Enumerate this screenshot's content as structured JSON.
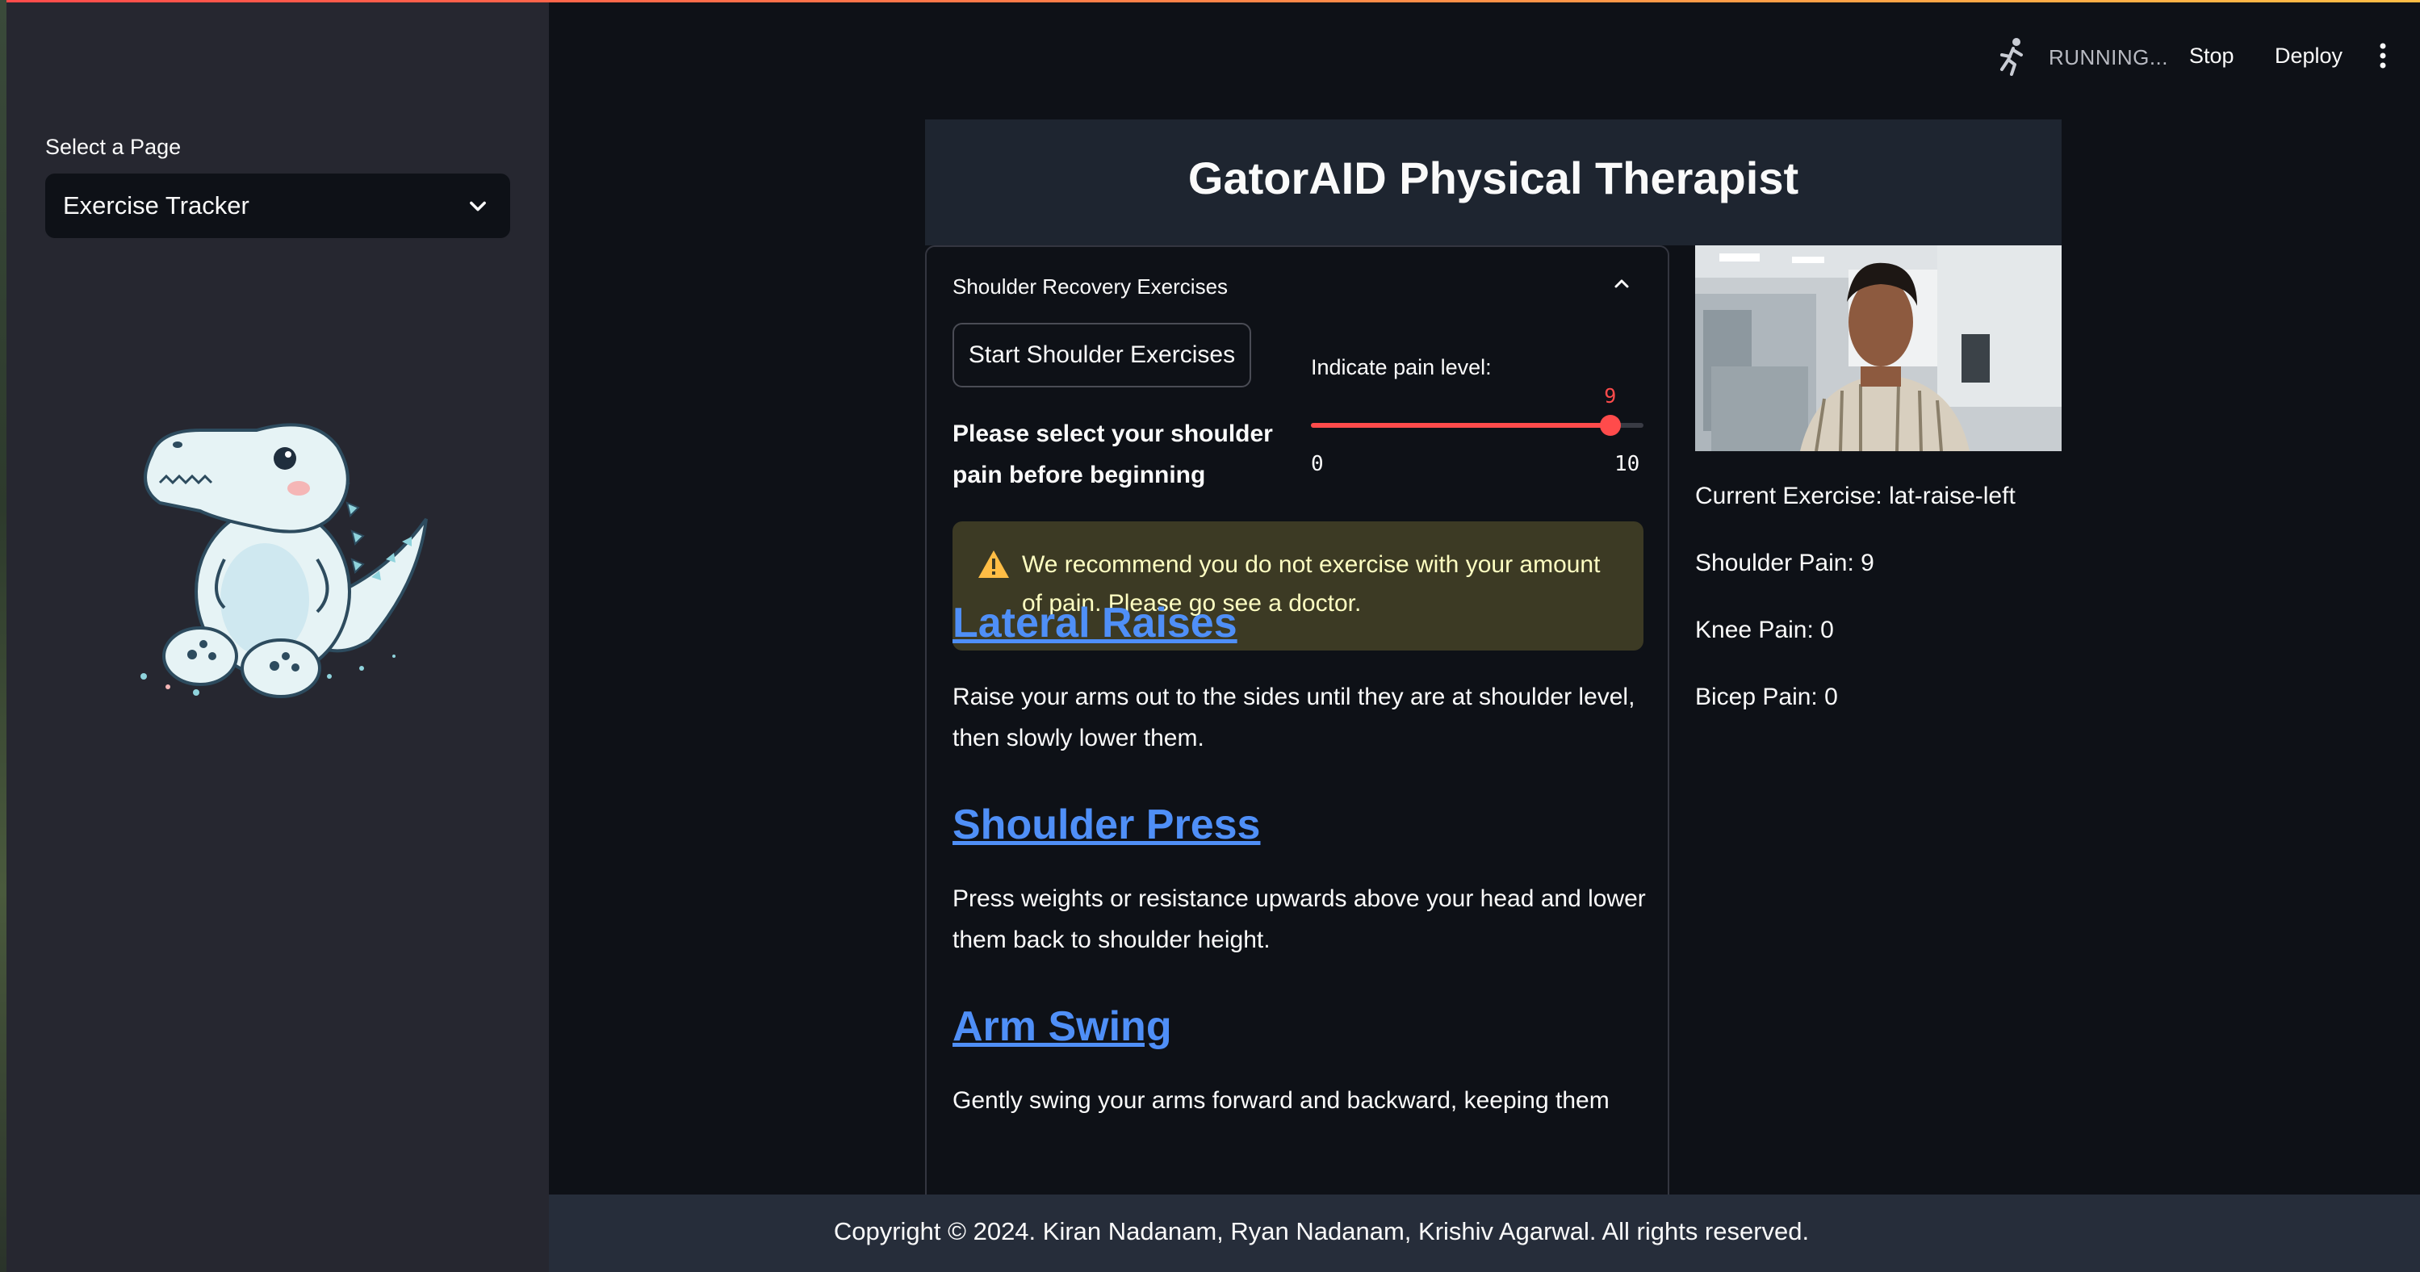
{
  "sidebar": {
    "select_label": "Select a Page",
    "selected_page": "Exercise Tracker",
    "mascot_icon": "alligator-mascot-icon"
  },
  "header": {
    "status": "RUNNING...",
    "stop_label": "Stop",
    "deploy_label": "Deploy",
    "status_icon": "running-person-icon",
    "menu_icon": "kebab-menu-icon"
  },
  "main": {
    "title": "GatorAID Physical Therapist",
    "expander_title": "Shoulder Recovery Exercises",
    "start_button": "Start Shoulder Exercises",
    "prompt": "Please select your shoulder pain before beginning",
    "pain_label": "Indicate pain level:",
    "pain_slider": {
      "value": "9",
      "min": "0",
      "max": "10",
      "value_fraction": 0.9
    },
    "warning": "We recommend you do not exercise with your amount of pain. Please go see a doctor.",
    "exercises": [
      {
        "name": "Lateral Raises",
        "description": "Raise your arms out to the sides until they are at shoulder level, then slowly lower them."
      },
      {
        "name": "Shoulder Press",
        "description": "Press weights or resistance upwards above your head and lower them back to shoulder height."
      },
      {
        "name": "Arm Swing",
        "description": "Gently swing your arms forward and backward, keeping them"
      }
    ]
  },
  "status_panel": {
    "current_exercise": "Current Exercise: lat-raise-left",
    "shoulder_pain": "Shoulder Pain: 9",
    "knee_pain": "Knee Pain: 0",
    "bicep_pain": "Bicep Pain: 0"
  },
  "footer": {
    "copyright": "Copyright © 2024. Kiran Nadanam, Ryan Nadanam, Krishiv Agarwal. All rights reserved."
  },
  "colors": {
    "accent": "#ff4b4b",
    "link": "#4f8ff7",
    "warning_bg": "#3c3a24",
    "warning_text": "#ffffc2"
  }
}
